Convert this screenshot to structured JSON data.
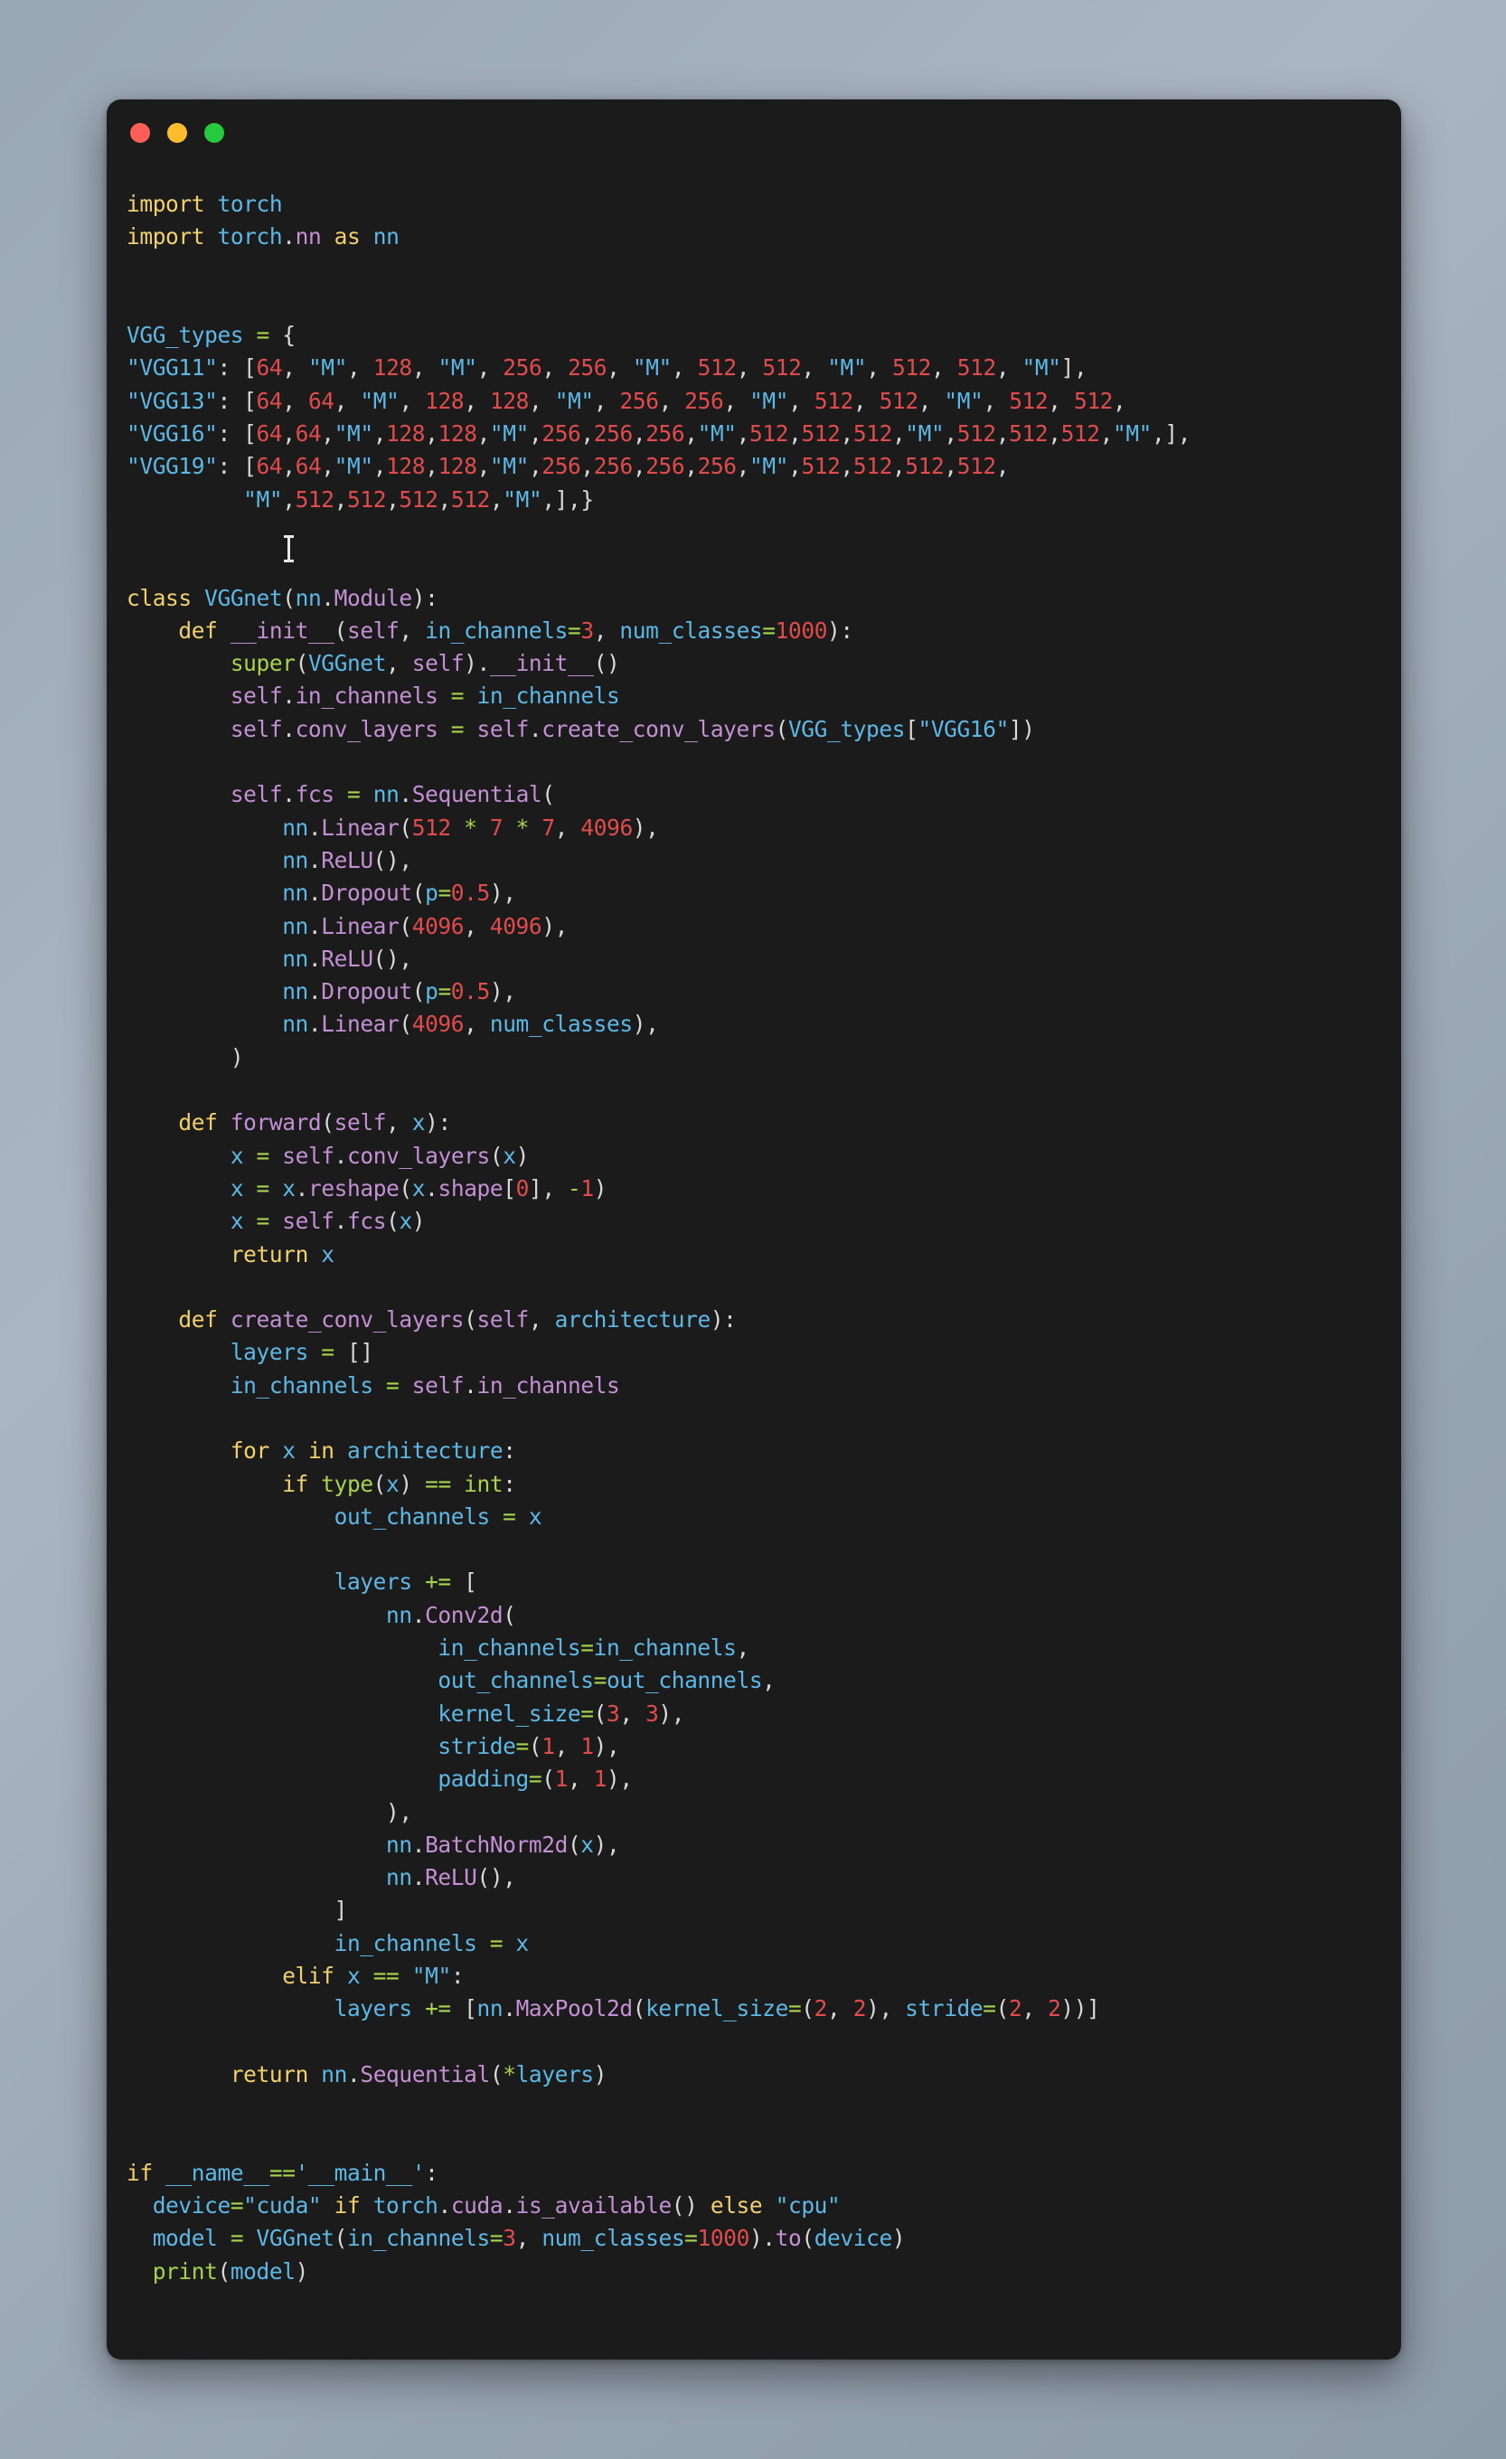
{
  "window": {
    "background_color": "#1b1b1b",
    "page_background_color": "#9aa7b4",
    "traffic_lights": [
      {
        "name": "close",
        "color": "#ff5f56"
      },
      {
        "name": "minimize",
        "color": "#ffbd2e"
      },
      {
        "name": "maximize",
        "color": "#27c93f"
      }
    ]
  },
  "cursor": {
    "type": "i-beam-text-cursor",
    "over_text": "VGG16"
  },
  "theme": {
    "keyword": "#f2d06b",
    "name": "#5cb8e6",
    "attribute": "#c48fd4",
    "builtin": "#a6d44a",
    "number": "#e14b4b",
    "string": "#5cb8e6",
    "operator": "#a6d44a",
    "punctuation": "#d8d8d8"
  },
  "code": {
    "language": "python",
    "title": "VGGnet implementation",
    "lines": [
      "import torch",
      "import torch.nn as nn",
      "",
      "",
      "VGG_types = {",
      "\"VGG11\": [64, \"M\", 128, \"M\", 256, 256, \"M\", 512, 512, \"M\", 512, 512, \"M\"],",
      "\"VGG13\": [64, 64, \"M\", 128, 128, \"M\", 256, 256, \"M\", 512, 512, \"M\", 512, 512,",
      "\"VGG16\": [64,64,\"M\",128,128,\"M\",256,256,256,\"M\",512,512,512,\"M\",512,512,512,\"M\",],",
      "\"VGG19\": [64,64,\"M\",128,128,\"M\",256,256,256,256,\"M\",512,512,512,512,",
      "          \"M\",512,512,512,512,\"M\",],}",
      "",
      "",
      "class VGGnet(nn.Module):",
      "    def __init__(self, in_channels=3, num_classes=1000):",
      "        super(VGGnet, self).__init__()",
      "        self.in_channels = in_channels",
      "        self.conv_layers = self.create_conv_layers(VGG_types[\"VGG16\"])",
      "",
      "        self.fcs = nn.Sequential(",
      "            nn.Linear(512 * 7 * 7, 4096),",
      "            nn.ReLU(),",
      "            nn.Dropout(p=0.5),",
      "            nn.Linear(4096, 4096),",
      "            nn.ReLU(),",
      "            nn.Dropout(p=0.5),",
      "            nn.Linear(4096, num_classes),",
      "        )",
      "",
      "    def forward(self, x):",
      "        x = self.conv_layers(x)",
      "        x = x.reshape(x.shape[0], -1)",
      "        x = self.fcs(x)",
      "        return x",
      "",
      "    def create_conv_layers(self, architecture):",
      "        layers = []",
      "        in_channels = self.in_channels",
      "",
      "        for x in architecture:",
      "            if type(x) == int:",
      "                out_channels = x",
      "",
      "                layers += [",
      "                    nn.Conv2d(",
      "                        in_channels=in_channels,",
      "                        out_channels=out_channels,",
      "                        kernel_size=(3, 3),",
      "                        stride=(1, 1),",
      "                        padding=(1, 1),",
      "                    ),",
      "                    nn.BatchNorm2d(x),",
      "                    nn.ReLU(),",
      "                ]",
      "                in_channels = x",
      "            elif x == \"M\":",
      "                layers += [nn.MaxPool2d(kernel_size=(2, 2), stride=(2, 2))]",
      "",
      "        return nn.Sequential(*layers)",
      "",
      "",
      "if __name__=='__main__':",
      "  device=\"cuda\" if torch.cuda.is_available() else \"cpu\"",
      "  model = VGGnet(in_channels=3, num_classes=1000).to(device)",
      "  print(model)"
    ],
    "html": "<span class=\"kw\">import</span> <span class=\"nm\">torch</span>\n<span class=\"kw\">import</span> <span class=\"nm\">torch</span><span class=\"pn\">.</span><span class=\"fn\">nn</span> <span class=\"kw\">as</span> <span class=\"nm\">nn</span>\n\n\n<span class=\"nm\">VGG_types</span> <span class=\"op\">=</span> <span class=\"pn\">{</span>\n<span class=\"str\">\"VGG11\"</span><span class=\"pn\">:</span> <span class=\"pn\">[</span><span class=\"num\">64</span><span class=\"pn\">,</span> <span class=\"str\">\"M\"</span><span class=\"pn\">,</span> <span class=\"num\">128</span><span class=\"pn\">,</span> <span class=\"str\">\"M\"</span><span class=\"pn\">,</span> <span class=\"num\">256</span><span class=\"pn\">,</span> <span class=\"num\">256</span><span class=\"pn\">,</span> <span class=\"str\">\"M\"</span><span class=\"pn\">,</span> <span class=\"num\">512</span><span class=\"pn\">,</span> <span class=\"num\">512</span><span class=\"pn\">,</span> <span class=\"str\">\"M\"</span><span class=\"pn\">,</span> <span class=\"num\">512</span><span class=\"pn\">,</span> <span class=\"num\">512</span><span class=\"pn\">,</span> <span class=\"str\">\"M\"</span><span class=\"pn\">],</span>\n<span class=\"str\">\"VGG13\"</span><span class=\"pn\">:</span> <span class=\"pn\">[</span><span class=\"num\">64</span><span class=\"pn\">,</span> <span class=\"num\">64</span><span class=\"pn\">,</span> <span class=\"str\">\"M\"</span><span class=\"pn\">,</span> <span class=\"num\">128</span><span class=\"pn\">,</span> <span class=\"num\">128</span><span class=\"pn\">,</span> <span class=\"str\">\"M\"</span><span class=\"pn\">,</span> <span class=\"num\">256</span><span class=\"pn\">,</span> <span class=\"num\">256</span><span class=\"pn\">,</span> <span class=\"str\">\"M\"</span><span class=\"pn\">,</span> <span class=\"num\">512</span><span class=\"pn\">,</span> <span class=\"num\">512</span><span class=\"pn\">,</span> <span class=\"str\">\"M\"</span><span class=\"pn\">,</span> <span class=\"num\">512</span><span class=\"pn\">,</span> <span class=\"num\">512</span><span class=\"pn\">,</span>\n<span class=\"str\">\"VGG16\"</span><span class=\"pn\">:</span> <span class=\"pn\">[</span><span class=\"num\">64</span><span class=\"pn\">,</span><span class=\"num\">64</span><span class=\"pn\">,</span><span class=\"str\">\"M\"</span><span class=\"pn\">,</span><span class=\"num\">128</span><span class=\"pn\">,</span><span class=\"num\">128</span><span class=\"pn\">,</span><span class=\"str\">\"M\"</span><span class=\"pn\">,</span><span class=\"num\">256</span><span class=\"pn\">,</span><span class=\"num\">256</span><span class=\"pn\">,</span><span class=\"num\">256</span><span class=\"pn\">,</span><span class=\"str\">\"M\"</span><span class=\"pn\">,</span><span class=\"num\">512</span><span class=\"pn\">,</span><span class=\"num\">512</span><span class=\"pn\">,</span><span class=\"num\">512</span><span class=\"pn\">,</span><span class=\"str\">\"M\"</span><span class=\"pn\">,</span><span class=\"num\">512</span><span class=\"pn\">,</span><span class=\"num\">512</span><span class=\"pn\">,</span><span class=\"num\">512</span><span class=\"pn\">,</span><span class=\"str\">\"M\"</span><span class=\"pn\">,],</span>\n<span class=\"str\">\"VGG19\"</span><span class=\"pn\">:</span> <span class=\"pn\">[</span><span class=\"num\">64</span><span class=\"pn\">,</span><span class=\"num\">64</span><span class=\"pn\">,</span><span class=\"str\">\"M\"</span><span class=\"pn\">,</span><span class=\"num\">128</span><span class=\"pn\">,</span><span class=\"num\">128</span><span class=\"pn\">,</span><span class=\"str\">\"M\"</span><span class=\"pn\">,</span><span class=\"num\">256</span><span class=\"pn\">,</span><span class=\"num\">256</span><span class=\"pn\">,</span><span class=\"num\">256</span><span class=\"pn\">,</span><span class=\"num\">256</span><span class=\"pn\">,</span><span class=\"str\">\"M\"</span><span class=\"pn\">,</span><span class=\"num\">512</span><span class=\"pn\">,</span><span class=\"num\">512</span><span class=\"pn\">,</span><span class=\"num\">512</span><span class=\"pn\">,</span><span class=\"num\">512</span><span class=\"pn\">,</span>\n         <span class=\"str\">\"M\"</span><span class=\"pn\">,</span><span class=\"num\">512</span><span class=\"pn\">,</span><span class=\"num\">512</span><span class=\"pn\">,</span><span class=\"num\">512</span><span class=\"pn\">,</span><span class=\"num\">512</span><span class=\"pn\">,</span><span class=\"str\">\"M\"</span><span class=\"pn\">,],}</span>\n\n\n<span class=\"kw\">class</span> <span class=\"nm\">VGGnet</span><span class=\"pn\">(</span><span class=\"nm\">nn</span><span class=\"pn\">.</span><span class=\"fn\">Module</span><span class=\"pn\">):</span>\n    <span class=\"kw\">def</span> <span class=\"fn\">__init__</span><span class=\"pn\">(</span><span class=\"self\">self</span><span class=\"pn\">,</span> <span class=\"nm\">in_channels</span><span class=\"op\">=</span><span class=\"num\">3</span><span class=\"pn\">,</span> <span class=\"nm\">num_classes</span><span class=\"op\">=</span><span class=\"num\">1000</span><span class=\"pn\">):</span>\n        <span class=\"bi\">super</span><span class=\"pn\">(</span><span class=\"nm\">VGGnet</span><span class=\"pn\">,</span> <span class=\"self\">self</span><span class=\"pn\">).</span><span class=\"fn\">__init__</span><span class=\"pn\">()</span>\n        <span class=\"self\">self</span><span class=\"pn\">.</span><span class=\"fn\">in_channels</span> <span class=\"op\">=</span> <span class=\"nm\">in_channels</span>\n        <span class=\"self\">self</span><span class=\"pn\">.</span><span class=\"fn\">conv_layers</span> <span class=\"op\">=</span> <span class=\"self\">self</span><span class=\"pn\">.</span><span class=\"fn\">create_conv_layers</span><span class=\"pn\">(</span><span class=\"nm\">VGG_types</span><span class=\"pn\">[</span><span class=\"str\">\"VGG16\"</span><span class=\"pn\">])</span>\n\n        <span class=\"self\">self</span><span class=\"pn\">.</span><span class=\"fn\">fcs</span> <span class=\"op\">=</span> <span class=\"nm\">nn</span><span class=\"pn\">.</span><span class=\"fn\">Sequential</span><span class=\"pn\">(</span>\n            <span class=\"nm\">nn</span><span class=\"pn\">.</span><span class=\"fn\">Linear</span><span class=\"pn\">(</span><span class=\"num\">512</span> <span class=\"op\">*</span> <span class=\"num\">7</span> <span class=\"op\">*</span> <span class=\"num\">7</span><span class=\"pn\">,</span> <span class=\"num\">4096</span><span class=\"pn\">),</span>\n            <span class=\"nm\">nn</span><span class=\"pn\">.</span><span class=\"fn\">ReLU</span><span class=\"pn\">(),</span>\n            <span class=\"nm\">nn</span><span class=\"pn\">.</span><span class=\"fn\">Dropout</span><span class=\"pn\">(</span><span class=\"nm\">p</span><span class=\"op\">=</span><span class=\"num\">0.5</span><span class=\"pn\">),</span>\n            <span class=\"nm\">nn</span><span class=\"pn\">.</span><span class=\"fn\">Linear</span><span class=\"pn\">(</span><span class=\"num\">4096</span><span class=\"pn\">,</span> <span class=\"num\">4096</span><span class=\"pn\">),</span>\n            <span class=\"nm\">nn</span><span class=\"pn\">.</span><span class=\"fn\">ReLU</span><span class=\"pn\">(),</span>\n            <span class=\"nm\">nn</span><span class=\"pn\">.</span><span class=\"fn\">Dropout</span><span class=\"pn\">(</span><span class=\"nm\">p</span><span class=\"op\">=</span><span class=\"num\">0.5</span><span class=\"pn\">),</span>\n            <span class=\"nm\">nn</span><span class=\"pn\">.</span><span class=\"fn\">Linear</span><span class=\"pn\">(</span><span class=\"num\">4096</span><span class=\"pn\">,</span> <span class=\"nm\">num_classes</span><span class=\"pn\">),</span>\n        <span class=\"pn\">)</span>\n\n    <span class=\"kw\">def</span> <span class=\"fn\">forward</span><span class=\"pn\">(</span><span class=\"self\">self</span><span class=\"pn\">,</span> <span class=\"nm\">x</span><span class=\"pn\">):</span>\n        <span class=\"nm\">x</span> <span class=\"op\">=</span> <span class=\"self\">self</span><span class=\"pn\">.</span><span class=\"fn\">conv_layers</span><span class=\"pn\">(</span><span class=\"nm\">x</span><span class=\"pn\">)</span>\n        <span class=\"nm\">x</span> <span class=\"op\">=</span> <span class=\"nm\">x</span><span class=\"pn\">.</span><span class=\"fn\">reshape</span><span class=\"pn\">(</span><span class=\"nm\">x</span><span class=\"pn\">.</span><span class=\"fn\">shape</span><span class=\"pn\">[</span><span class=\"num\">0</span><span class=\"pn\">],</span> <span class=\"op\">-</span><span class=\"num\">1</span><span class=\"pn\">)</span>\n        <span class=\"nm\">x</span> <span class=\"op\">=</span> <span class=\"self\">self</span><span class=\"pn\">.</span><span class=\"fn\">fcs</span><span class=\"pn\">(</span><span class=\"nm\">x</span><span class=\"pn\">)</span>\n        <span class=\"kw\">return</span> <span class=\"nm\">x</span>\n\n    <span class=\"kw\">def</span> <span class=\"fn\">create_conv_layers</span><span class=\"pn\">(</span><span class=\"self\">self</span><span class=\"pn\">,</span> <span class=\"nm\">architecture</span><span class=\"pn\">):</span>\n        <span class=\"nm\">layers</span> <span class=\"op\">=</span> <span class=\"pn\">[]</span>\n        <span class=\"nm\">in_channels</span> <span class=\"op\">=</span> <span class=\"self\">self</span><span class=\"pn\">.</span><span class=\"fn\">in_channels</span>\n\n        <span class=\"kw\">for</span> <span class=\"nm\">x</span> <span class=\"kw\">in</span> <span class=\"nm\">architecture</span><span class=\"pn\">:</span>\n            <span class=\"kw\">if</span> <span class=\"bi\">type</span><span class=\"pn\">(</span><span class=\"nm\">x</span><span class=\"pn\">)</span> <span class=\"op\">==</span> <span class=\"bi\">int</span><span class=\"pn\">:</span>\n                <span class=\"nm\">out_channels</span> <span class=\"op\">=</span> <span class=\"nm\">x</span>\n\n                <span class=\"nm\">layers</span> <span class=\"op\">+=</span> <span class=\"pn\">[</span>\n                    <span class=\"nm\">nn</span><span class=\"pn\">.</span><span class=\"fn\">Conv2d</span><span class=\"pn\">(</span>\n                        <span class=\"nm\">in_channels</span><span class=\"op\">=</span><span class=\"nm\">in_channels</span><span class=\"pn\">,</span>\n                        <span class=\"nm\">out_channels</span><span class=\"op\">=</span><span class=\"nm\">out_channels</span><span class=\"pn\">,</span>\n                        <span class=\"nm\">kernel_size</span><span class=\"op\">=</span><span class=\"pn\">(</span><span class=\"num\">3</span><span class=\"pn\">,</span> <span class=\"num\">3</span><span class=\"pn\">),</span>\n                        <span class=\"nm\">stride</span><span class=\"op\">=</span><span class=\"pn\">(</span><span class=\"num\">1</span><span class=\"pn\">,</span> <span class=\"num\">1</span><span class=\"pn\">),</span>\n                        <span class=\"nm\">padding</span><span class=\"op\">=</span><span class=\"pn\">(</span><span class=\"num\">1</span><span class=\"pn\">,</span> <span class=\"num\">1</span><span class=\"pn\">),</span>\n                    <span class=\"pn\">),</span>\n                    <span class=\"nm\">nn</span><span class=\"pn\">.</span><span class=\"fn\">BatchNorm2d</span><span class=\"pn\">(</span><span class=\"nm\">x</span><span class=\"pn\">),</span>\n                    <span class=\"nm\">nn</span><span class=\"pn\">.</span><span class=\"fn\">ReLU</span><span class=\"pn\">(),</span>\n                <span class=\"pn\">]</span>\n                <span class=\"nm\">in_channels</span> <span class=\"op\">=</span> <span class=\"nm\">x</span>\n            <span class=\"kw\">elif</span> <span class=\"nm\">x</span> <span class=\"op\">==</span> <span class=\"str\">\"M\"</span><span class=\"pn\">:</span>\n                <span class=\"nm\">layers</span> <span class=\"op\">+=</span> <span class=\"pn\">[</span><span class=\"nm\">nn</span><span class=\"pn\">.</span><span class=\"fn\">MaxPool2d</span><span class=\"pn\">(</span><span class=\"nm\">kernel_size</span><span class=\"op\">=</span><span class=\"pn\">(</span><span class=\"num\">2</span><span class=\"pn\">,</span> <span class=\"num\">2</span><span class=\"pn\">),</span> <span class=\"nm\">stride</span><span class=\"op\">=</span><span class=\"pn\">(</span><span class=\"num\">2</span><span class=\"pn\">,</span> <span class=\"num\">2</span><span class=\"pn\">))]</span>\n\n        <span class=\"kw\">return</span> <span class=\"nm\">nn</span><span class=\"pn\">.</span><span class=\"fn\">Sequential</span><span class=\"pn\">(</span><span class=\"op\">*</span><span class=\"nm\">layers</span><span class=\"pn\">)</span>\n\n\n<span class=\"kw\">if</span> <span class=\"nm\">__name__</span><span class=\"op\">==</span><span class=\"str\">'__main__'</span><span class=\"pn\">:</span>\n  <span class=\"nm\">device</span><span class=\"op\">=</span><span class=\"str\">\"cuda\"</span> <span class=\"kw\">if</span> <span class=\"nm\">torch</span><span class=\"pn\">.</span><span class=\"fn\">cuda</span><span class=\"pn\">.</span><span class=\"fn\">is_available</span><span class=\"pn\">()</span> <span class=\"kw\">else</span> <span class=\"str\">\"cpu\"</span>\n  <span class=\"nm\">model</span> <span class=\"op\">=</span> <span class=\"nm\">VGGnet</span><span class=\"pn\">(</span><span class=\"nm\">in_channels</span><span class=\"op\">=</span><span class=\"num\">3</span><span class=\"pn\">,</span> <span class=\"nm\">num_classes</span><span class=\"op\">=</span><span class=\"num\">1000</span><span class=\"pn\">).</span><span class=\"fn\">to</span><span class=\"pn\">(</span><span class=\"nm\">device</span><span class=\"pn\">)</span>\n  <span class=\"bi\">print</span><span class=\"pn\">(</span><span class=\"nm\">model</span><span class=\"pn\">)</span>"
  }
}
